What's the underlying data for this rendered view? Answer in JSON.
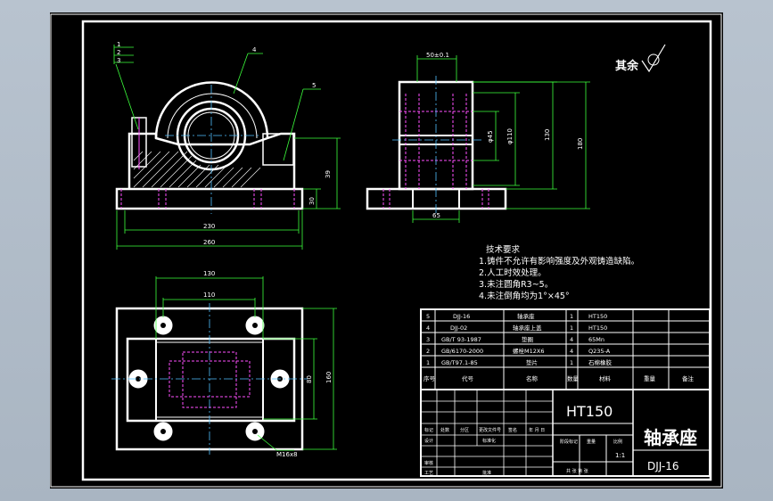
{
  "surface_note": {
    "label": "其余"
  },
  "balloons": [
    "1",
    "2",
    "3",
    "4",
    "5"
  ],
  "front_view": {
    "dim_width": "230",
    "dim_total": "260",
    "dim_height": "39",
    "dim_base": "30"
  },
  "side_view": {
    "dim_top": "50±0.1",
    "dim_d_inner": "φ45",
    "dim_d_outer": "φ110",
    "dim_h1": "130",
    "dim_h2": "180",
    "dim_bottom": "65"
  },
  "top_view": {
    "dim_outer": "130",
    "dim_inner": "110",
    "dim_right1": "80",
    "dim_right2": "160",
    "thread": "M16x8"
  },
  "tech_requirements": {
    "title": "技术要求",
    "items": [
      "1.铸件不允许有影响强度及外观铸造缺陷。",
      "2.人工时效处理。",
      "3.未注圆角R3~5。",
      "4.未注倒角均为1°×45°"
    ]
  },
  "bom": {
    "rows": [
      {
        "no": "5",
        "code": "DJJ-16",
        "name": "轴承座",
        "qty": "1",
        "material": "HT150"
      },
      {
        "no": "4",
        "code": "DJJ-02",
        "name": "轴承座上盖",
        "qty": "1",
        "material": "HT150"
      },
      {
        "no": "3",
        "code": "GB/T 93-1987",
        "name": "垫圈",
        "qty": "4",
        "material": "65Mn"
      },
      {
        "no": "2",
        "code": "GB/6170-2000",
        "name": "螺栓M12X6",
        "qty": "4",
        "material": "Q235-A"
      },
      {
        "no": "1",
        "code": "GB/T97.1-85",
        "name": "垫片",
        "qty": "1",
        "material": "石棉橡胶"
      }
    ],
    "headers": {
      "no": "序号",
      "code": "代号",
      "name": "名称",
      "qty": "数量",
      "material": "材料",
      "weight": "重量",
      "remark": "备注"
    }
  },
  "title_block": {
    "material": "HT150",
    "part_name": "轴承座",
    "drawing_no": "DJJ-16",
    "scale": "1:1",
    "row_labels": [
      "标记",
      "处数",
      "分区",
      "更改文件号",
      "签名",
      "年 月 日"
    ],
    "row2_labels": [
      "设计",
      "标准化"
    ],
    "stage_label": "阶段标记",
    "weight_label": "重量",
    "scale_label": "比例",
    "bottom_labels": [
      "审核",
      "工艺",
      "批准"
    ],
    "sheet_label": "共 张 第 张"
  }
}
